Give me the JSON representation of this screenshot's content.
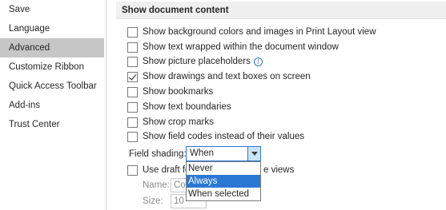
{
  "nav": {
    "items": [
      {
        "label": "Save"
      },
      {
        "label": "Language"
      },
      {
        "label": "Advanced"
      },
      {
        "label": "Customize Ribbon"
      },
      {
        "label": "Quick Access Toolbar"
      },
      {
        "label": "Add-ins"
      },
      {
        "label": "Trust Center"
      }
    ],
    "selected": "Advanced"
  },
  "section": {
    "title": "Show document content"
  },
  "options": [
    {
      "label": "Show background colors and images in Print Layout view",
      "checked": false
    },
    {
      "label": "Show text wrapped within the document window",
      "checked": false
    },
    {
      "label": "Show picture placeholders",
      "checked": false,
      "has_info_icon": true
    },
    {
      "label": "Show drawings and text boxes on screen",
      "checked": true
    },
    {
      "label": "Show bookmarks",
      "checked": false
    },
    {
      "label": "Show text boundaries",
      "checked": false
    },
    {
      "label": "Show crop marks",
      "checked": false
    },
    {
      "label": "Show field codes instead of their values",
      "checked": false
    }
  ],
  "field_shading": {
    "label": "Field shading:",
    "value": "When selected",
    "options": [
      "Never",
      "Always",
      "When selected"
    ],
    "highlighted": "Always"
  },
  "draft": {
    "label_start": "Use draft fo",
    "label_end": "e views",
    "checked": false,
    "name_label": "Name:",
    "name_value": "Co",
    "size_label": "Size:",
    "size_value": "10"
  },
  "icons": {
    "info": "info-icon",
    "dropdown_arrow": "chevron-down-icon",
    "check": "checkmark-icon"
  },
  "colors": {
    "accent": "#2b78d4",
    "selected_nav": "#c6c6c6",
    "header_bg": "#f0f0f0"
  }
}
